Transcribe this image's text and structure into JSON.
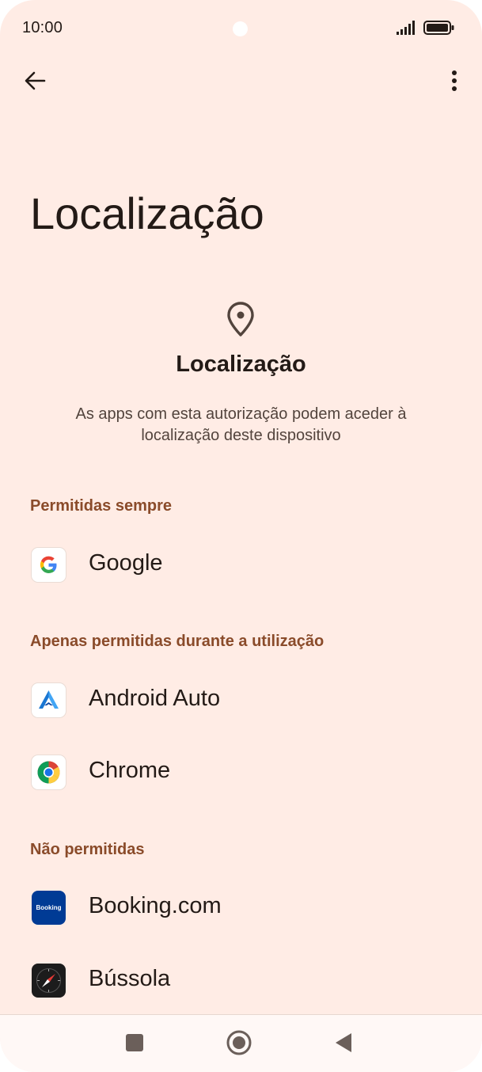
{
  "status_bar": {
    "time": "10:00"
  },
  "header": {
    "title": "Localização"
  },
  "hero": {
    "icon": "location-pin-icon",
    "title": "Localização",
    "description": "As apps com esta autorização podem aceder à localização deste dispositivo"
  },
  "sections": [
    {
      "header": "Permitidas sempre",
      "apps": [
        {
          "name": "Google",
          "icon": "google-icon"
        }
      ]
    },
    {
      "header": "Apenas permitidas durante a utilização",
      "apps": [
        {
          "name": "Android Auto",
          "icon": "android-auto-icon"
        },
        {
          "name": "Chrome",
          "icon": "chrome-icon"
        }
      ]
    },
    {
      "header": "Não permitidas",
      "apps": [
        {
          "name": "Booking.com",
          "icon": "booking-icon",
          "icon_text": "Booking"
        },
        {
          "name": "Bússola",
          "icon": "compass-icon"
        }
      ]
    }
  ],
  "colors": {
    "background": "#ffece5",
    "section_header": "#8a4b2a",
    "text": "#231a16"
  }
}
